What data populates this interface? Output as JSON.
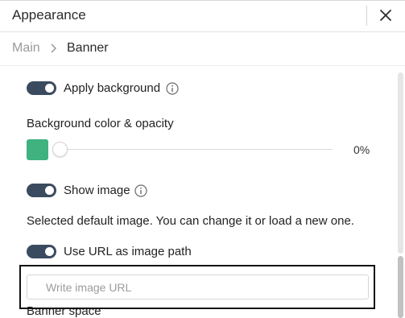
{
  "header": {
    "title": "Appearance"
  },
  "breadcrumb": {
    "root": "Main",
    "current": "Banner"
  },
  "settings": {
    "apply_background": {
      "label": "Apply background",
      "enabled": true
    },
    "bg_color": {
      "label": "Background color & opacity",
      "color": "#3fb27f",
      "opacity_value": "0%"
    },
    "show_image": {
      "label": "Show image",
      "enabled": true
    },
    "default_image_note": "Selected default image. You can change it or load a new one.",
    "use_url": {
      "label": "Use URL as image path",
      "enabled": true
    },
    "url_input": {
      "placeholder": "Write image URL",
      "value": ""
    },
    "banner_space": {
      "label": "Banner space"
    }
  },
  "colors": {
    "toggle_on": "#3b4b5f",
    "swatch": "#3fb27f",
    "highlight": "#111111"
  }
}
